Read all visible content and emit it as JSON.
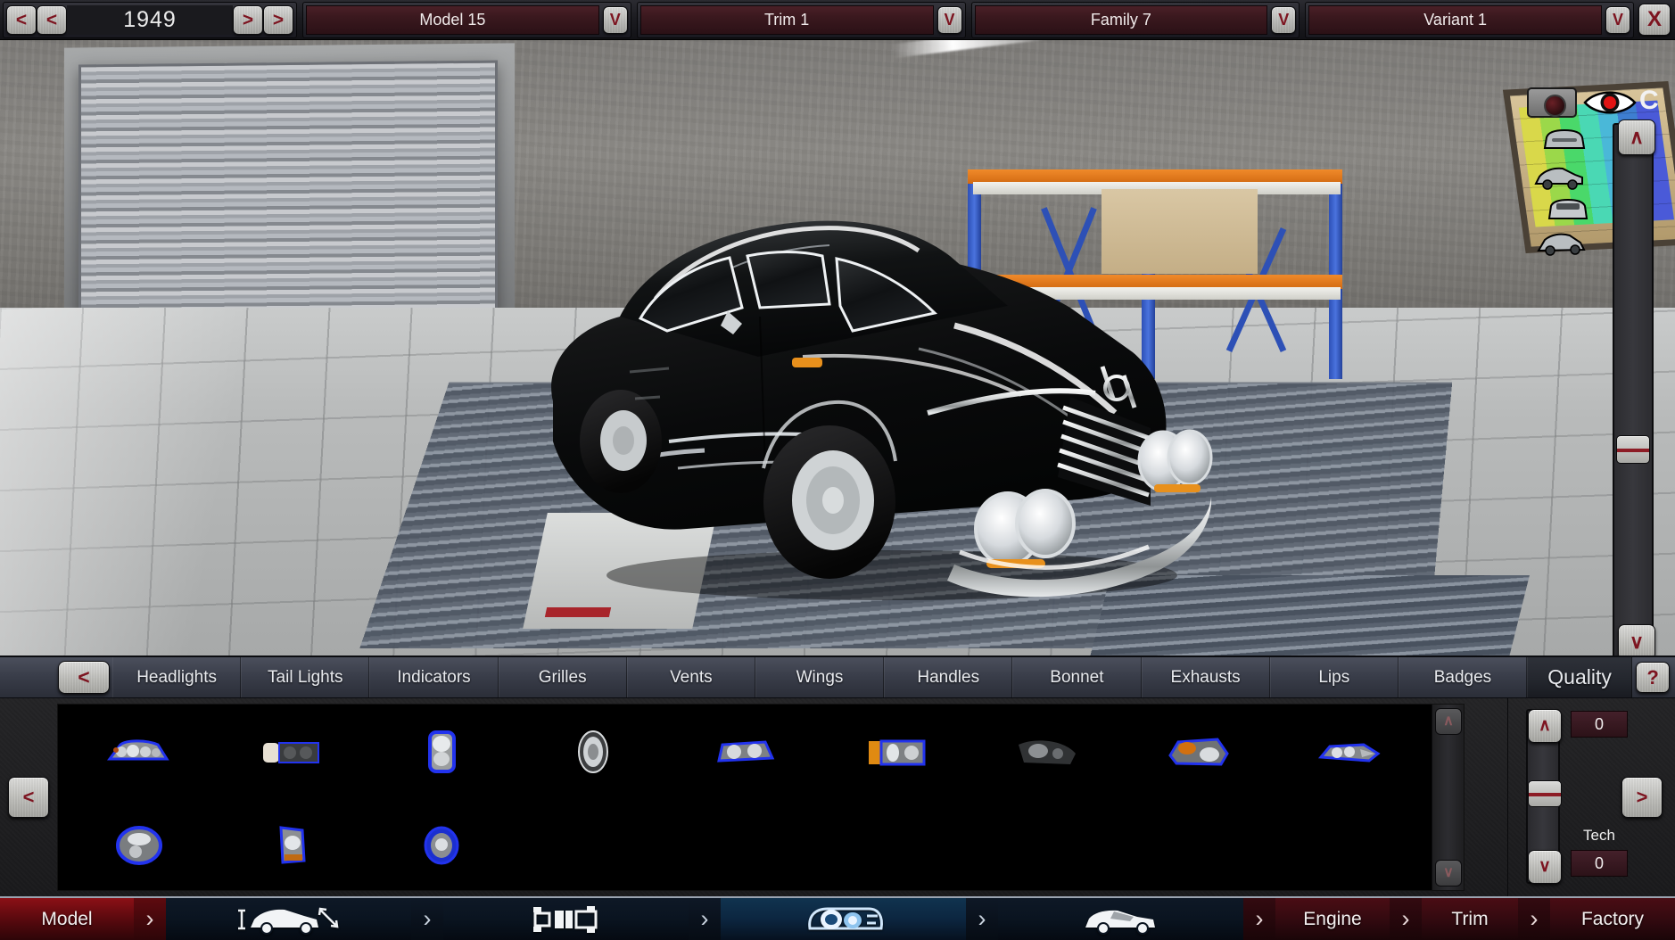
{
  "topbar": {
    "prev_fast": "<",
    "prev": "<",
    "year": "1949",
    "next": ">",
    "next_fast": ">",
    "dropdown_caret": "V",
    "model": "Model 15",
    "trim": "Trim 1",
    "family": "Family 7",
    "variant": "Variant 1",
    "close": "X"
  },
  "viewport": {
    "camera_icon": "camera-icon",
    "eye_icon": "eye-visible-icon",
    "eye_off_icon": "eye-hidden-icon",
    "scroll_up": "∧",
    "scroll_down": "∨",
    "view_icons": [
      "front-view-icon",
      "side-view-icon",
      "rear-view-icon",
      "three-quarter-view-icon"
    ]
  },
  "tabbar": {
    "back_label": "<",
    "tabs": [
      {
        "label": "Headlights",
        "active": true
      },
      {
        "label": "Tail Lights",
        "active": false
      },
      {
        "label": "Indicators",
        "active": false
      },
      {
        "label": "Grilles",
        "active": false
      },
      {
        "label": "Vents",
        "active": false
      },
      {
        "label": "Wings",
        "active": false
      },
      {
        "label": "Handles",
        "active": false
      },
      {
        "label": "Bonnet",
        "active": false
      },
      {
        "label": "Exhausts",
        "active": false
      },
      {
        "label": "Lips",
        "active": false
      },
      {
        "label": "Badges",
        "active": false
      }
    ],
    "quality_label": "Quality",
    "help_label": "?"
  },
  "parts": {
    "prev_page": "<",
    "next_page": ">",
    "scroll_up": "∧",
    "scroll_down": "∨",
    "items": [
      {
        "name": "headlight-quad-round-chrome",
        "selected": true,
        "shape": "quad-round"
      },
      {
        "name": "headlight-rectangular-dual",
        "selected": false,
        "shape": "rect-dual"
      },
      {
        "name": "headlight-tall-vertical",
        "selected": true,
        "shape": "tall-vert"
      },
      {
        "name": "headlight-single-round",
        "selected": false,
        "shape": "round"
      },
      {
        "name": "headlight-dual-wedge",
        "selected": true,
        "shape": "dual-wedge"
      },
      {
        "name": "headlight-amber-side",
        "selected": true,
        "shape": "amber-side"
      },
      {
        "name": "headlight-teardrop-dark",
        "selected": false,
        "shape": "teardrop"
      },
      {
        "name": "headlight-projector-amber",
        "selected": true,
        "shape": "projector"
      },
      {
        "name": "headlight-slim-twin",
        "selected": true,
        "shape": "slim-twin"
      },
      {
        "name": "headlight-oval-dual",
        "selected": true,
        "shape": "oval-dual"
      },
      {
        "name": "headlight-angular-amber",
        "selected": true,
        "shape": "angular"
      },
      {
        "name": "headlight-small-round-ring",
        "selected": true,
        "shape": "ring"
      }
    ]
  },
  "quality": {
    "increase": "∧",
    "decrease": "∨",
    "value": "0",
    "tech_label": "Tech",
    "tech_value": "0",
    "next": ">"
  },
  "bottomnav": {
    "items": [
      {
        "label": "Model",
        "type": "text",
        "style": "red"
      },
      {
        "label": "",
        "type": "icon",
        "icon": "car-dimensions-icon",
        "style": "dark"
      },
      {
        "label": "",
        "type": "icon",
        "icon": "chassis-icon",
        "style": "dark"
      },
      {
        "label": "",
        "type": "icon",
        "icon": "headlight-body-icon",
        "style": "blue",
        "active": true
      },
      {
        "label": "",
        "type": "icon",
        "icon": "car-body-icon",
        "style": "dark"
      },
      {
        "label": "Engine",
        "type": "text",
        "style": "maroon"
      },
      {
        "label": "Trim",
        "type": "text",
        "style": "maroon"
      },
      {
        "label": "Factory",
        "type": "text",
        "style": "maroon"
      }
    ],
    "separator": "›"
  },
  "colors": {
    "accent_red": "#7d1420",
    "panel_dark": "#1a1a1c",
    "tab_blue_gray": "#3a3e4a",
    "field_maroon": "#3a181e",
    "selected_blue": "#2233ee"
  }
}
